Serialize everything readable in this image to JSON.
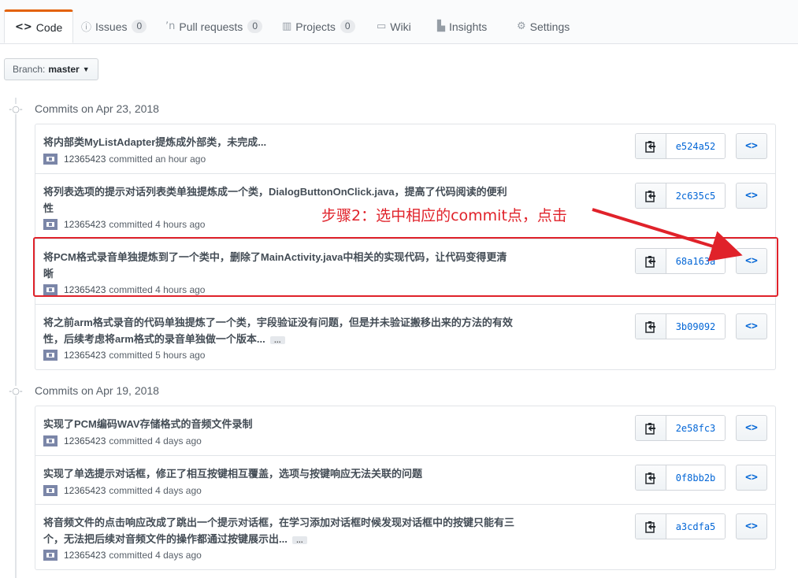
{
  "tabs": [
    {
      "label": "Code",
      "icon": "code-icon",
      "count": null,
      "selected": true
    },
    {
      "label": "Issues",
      "icon": "issue-icon",
      "count": "0",
      "selected": false
    },
    {
      "label": "Pull requests",
      "icon": "pull-request-icon",
      "count": "0",
      "selected": false
    },
    {
      "label": "Projects",
      "icon": "project-icon",
      "count": "0",
      "selected": false
    },
    {
      "label": "Wiki",
      "icon": "book-icon",
      "count": null,
      "selected": false
    },
    {
      "label": "Insights",
      "icon": "graph-icon",
      "count": null,
      "selected": false
    },
    {
      "label": "Settings",
      "icon": "gear-icon",
      "count": null,
      "selected": false
    }
  ],
  "branch": {
    "label": "Branch:",
    "value": "master"
  },
  "groups": [
    {
      "date": "Commits on Apr 23, 2018",
      "commits": [
        {
          "message": "将内部类MyListAdapter提炼成外部类，未完成...",
          "has_ellipsis": false,
          "author": "12365423",
          "action": "committed",
          "time": "an hour ago",
          "sha": "e524a52"
        },
        {
          "message": "将列表选项的提示对话列表类单独提炼成一个类，DialogButtonOnClick.java，提高了代码阅读的便利性",
          "has_ellipsis": false,
          "author": "12365423",
          "action": "committed",
          "time": "4 hours ago",
          "sha": "2c635c5"
        },
        {
          "message": "将PCM格式录音单独提炼到了一个类中，删除了MainActivity.java中相关的实现代码，让代码变得更清晰",
          "has_ellipsis": false,
          "author": "12365423",
          "action": "committed",
          "time": "4 hours ago",
          "sha": "68a163a"
        },
        {
          "message": "将之前arm格式录音的代码单独提炼了一个类，宇段验证没有问题，但是并未验证搬移出来的方法的有效性，后续考虑将arm格式的录音单独做一个版本...",
          "has_ellipsis": true,
          "author": "12365423",
          "action": "committed",
          "time": "5 hours ago",
          "sha": "3b09092"
        }
      ]
    },
    {
      "date": "Commits on Apr 19, 2018",
      "commits": [
        {
          "message": "实现了PCM编码WAV存储格式的音频文件录制",
          "has_ellipsis": false,
          "author": "12365423",
          "action": "committed",
          "time": "4 days ago",
          "sha": "2e58fc3"
        },
        {
          "message": "实现了单选提示对话框，修正了相互按键相互覆盖，选项与按键响应无法关联的问题",
          "has_ellipsis": false,
          "author": "12365423",
          "action": "committed",
          "time": "4 days ago",
          "sha": "0f8bb2b"
        },
        {
          "message": "将音频文件的点击响应改成了跳出一个提示对话框，在学习添加对话框时候发现对话框中的按键只能有三个，无法把后续对音频文件的操作都通过按键展示出...",
          "has_ellipsis": true,
          "author": "12365423",
          "action": "committed",
          "time": "4 days ago",
          "sha": "a3cdfa5"
        }
      ]
    }
  ],
  "ellipsis_label": "…",
  "browse_glyph": "<>",
  "annotation": {
    "text": "步骤2：选中相应的commit点，点击",
    "color": "#e0222a"
  },
  "colors": {
    "tab_accent": "#e36209",
    "link": "#0366d6",
    "annotation": "#e0222a"
  }
}
